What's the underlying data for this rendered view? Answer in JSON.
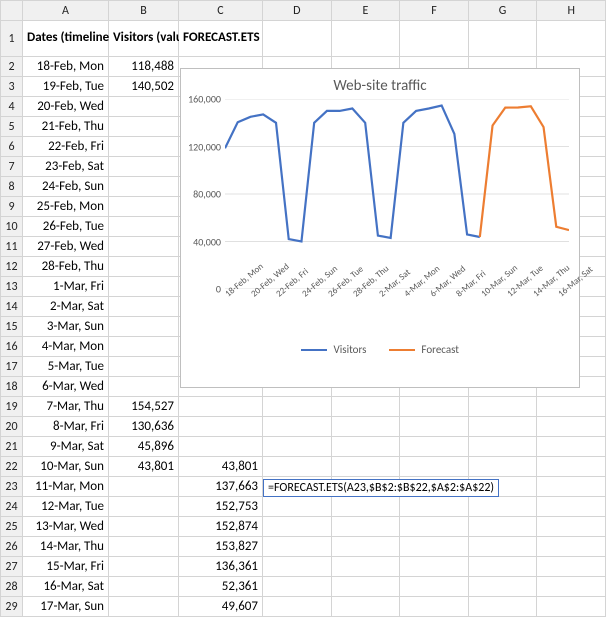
{
  "columns": [
    "A",
    "B",
    "C",
    "D",
    "E",
    "F",
    "G",
    "H"
  ],
  "headers": {
    "A": "Dates (timeline)",
    "B": "Visitors (values)",
    "C": "FORECAST.ETS"
  },
  "rows": [
    {
      "r": 2,
      "date": "18-Feb, Mon",
      "visitors": "118,488"
    },
    {
      "r": 3,
      "date": "19-Feb, Tue",
      "visitors": "140,502"
    },
    {
      "r": 4,
      "date": "20-Feb, Wed"
    },
    {
      "r": 5,
      "date": "21-Feb, Thu"
    },
    {
      "r": 6,
      "date": "22-Feb, Fri"
    },
    {
      "r": 7,
      "date": "23-Feb, Sat"
    },
    {
      "r": 8,
      "date": "24-Feb, Sun"
    },
    {
      "r": 9,
      "date": "25-Feb, Mon"
    },
    {
      "r": 10,
      "date": "26-Feb, Tue"
    },
    {
      "r": 11,
      "date": "27-Feb, Wed"
    },
    {
      "r": 12,
      "date": "28-Feb, Thu"
    },
    {
      "r": 13,
      "date": "1-Mar, Fri"
    },
    {
      "r": 14,
      "date": "2-Mar, Sat"
    },
    {
      "r": 15,
      "date": "3-Mar, Sun"
    },
    {
      "r": 16,
      "date": "4-Mar, Mon"
    },
    {
      "r": 17,
      "date": "5-Mar, Tue"
    },
    {
      "r": 18,
      "date": "6-Mar, Wed"
    },
    {
      "r": 19,
      "date": "7-Mar, Thu",
      "visitors": "154,527"
    },
    {
      "r": 20,
      "date": "8-Mar, Fri",
      "visitors": "130,636"
    },
    {
      "r": 21,
      "date": "9-Mar, Sat",
      "visitors": "45,896"
    },
    {
      "r": 22,
      "date": "10-Mar, Sun",
      "visitors": "43,801",
      "forecast": "43,801"
    },
    {
      "r": 23,
      "date": "11-Mar, Mon",
      "forecast": "137,663"
    },
    {
      "r": 24,
      "date": "12-Mar, Tue",
      "forecast": "152,753"
    },
    {
      "r": 25,
      "date": "13-Mar, Wed",
      "forecast": "152,874"
    },
    {
      "r": 26,
      "date": "14-Mar, Thu",
      "forecast": "153,827"
    },
    {
      "r": 27,
      "date": "15-Mar, Fri",
      "forecast": "136,361"
    },
    {
      "r": 28,
      "date": "16-Mar, Sat",
      "forecast": "52,361"
    },
    {
      "r": 29,
      "date": "17-Mar, Sun",
      "forecast": "49,607"
    }
  ],
  "formula_callout": "=FORECAST.ETS(A23,$B$2:$B$22,$A$2:$A$22)",
  "chart_data": {
    "type": "line",
    "title": "Web-site traffic",
    "ylim": [
      0,
      160000
    ],
    "yticks": [
      0,
      40000,
      80000,
      120000,
      160000
    ],
    "ytick_labels": [
      "0",
      "40,000",
      "80,000",
      "120,000",
      "160,000"
    ],
    "categories": [
      "18-Feb, Mon",
      "19-Feb, Tue",
      "20-Feb, Wed",
      "21-Feb, Thu",
      "22-Feb, Fri",
      "23-Feb, Sat",
      "24-Feb, Sun",
      "25-Feb, Mon",
      "26-Feb, Tue",
      "27-Feb, Wed",
      "28-Feb, Thu",
      "1-Mar, Fri",
      "2-Mar, Sat",
      "3-Mar, Sun",
      "4-Mar, Mon",
      "5-Mar, Tue",
      "6-Mar, Wed",
      "7-Mar, Thu",
      "8-Mar, Fri",
      "9-Mar, Sat",
      "10-Mar, Sun",
      "11-Mar, Mon",
      "12-Mar, Tue",
      "13-Mar, Wed",
      "14-Mar, Thu",
      "15-Mar, Fri",
      "16-Mar, Sat",
      "17-Mar, Sun"
    ],
    "xtick_labels": [
      "18-Feb, Mon",
      "20-Feb, Wed",
      "22-Feb, Fri",
      "24-Feb, Sun",
      "26-Feb, Tue",
      "28-Feb, Thu",
      "2-Mar, Sat",
      "4-Mar, Mon",
      "6-Mar, Wed",
      "8-Mar, Fri",
      "10-Mar, Sun",
      "12-Mar, Tue",
      "14-Mar, Thu",
      "16-Mar, Sat"
    ],
    "series": [
      {
        "name": "Visitors",
        "color": "#4472c4",
        "values": [
          118488,
          140502,
          145000,
          147000,
          140000,
          42000,
          40000,
          140000,
          150000,
          150000,
          152000,
          140000,
          45000,
          43000,
          140000,
          150000,
          152000,
          154527,
          130636,
          45896,
          43801,
          null,
          null,
          null,
          null,
          null,
          null,
          null
        ]
      },
      {
        "name": "Forecast",
        "color": "#ed7d31",
        "values": [
          null,
          null,
          null,
          null,
          null,
          null,
          null,
          null,
          null,
          null,
          null,
          null,
          null,
          null,
          null,
          null,
          null,
          null,
          null,
          null,
          43801,
          137663,
          152753,
          152874,
          153827,
          136361,
          52361,
          49607
        ]
      }
    ],
    "legend": [
      "Visitors",
      "Forecast"
    ]
  }
}
